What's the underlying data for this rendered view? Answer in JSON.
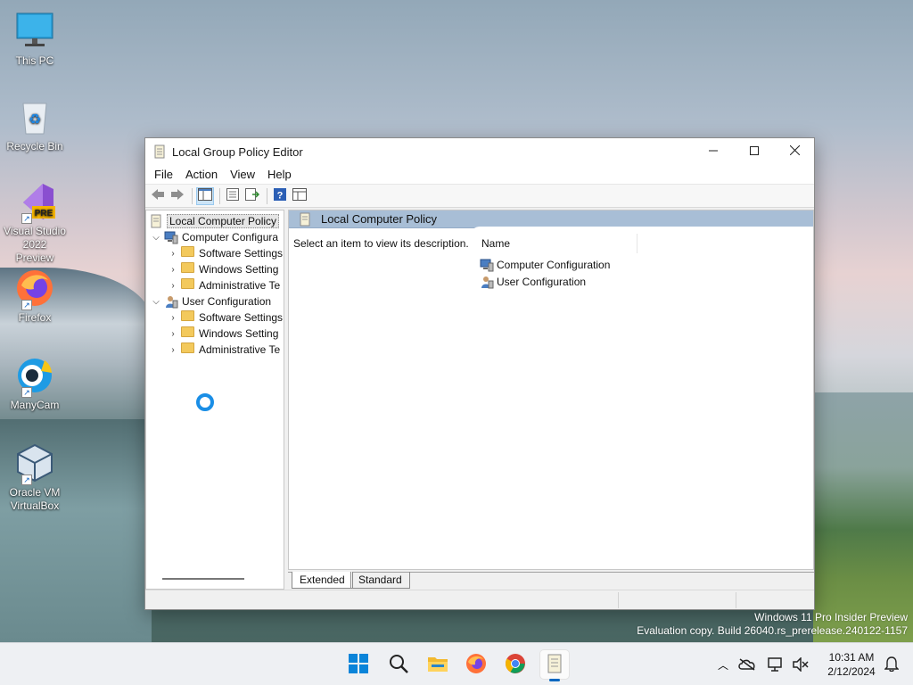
{
  "desktop": {
    "icons": [
      {
        "label": "This PC",
        "icon": "monitor-icon"
      },
      {
        "label": "Recycle Bin",
        "icon": "recycle-bin-icon"
      },
      {
        "label_line1": "Visual Studio",
        "label_line2": "2022 Preview",
        "badge": "PRE",
        "icon": "visual-studio-icon"
      },
      {
        "label": "Firefox",
        "icon": "firefox-icon"
      },
      {
        "label": "ManyCam",
        "icon": "manycam-icon"
      },
      {
        "label_line1": "Oracle VM",
        "label_line2": "VirtualBox",
        "icon": "virtualbox-icon"
      }
    ],
    "watermark": {
      "line1": "Windows 11 Pro Insider Preview",
      "line2": "Evaluation copy. Build 26040.rs_prerelease.240122-1157"
    }
  },
  "window": {
    "title": "Local Group Policy Editor",
    "controls": {
      "minimize": "minimize-icon",
      "maximize": "maximize-icon",
      "close": "close-icon"
    },
    "menu": [
      "File",
      "Action",
      "View",
      "Help"
    ],
    "toolbar": [
      "back-arrow-icon",
      "forward-arrow-icon",
      "show-hide-console-tree-icon",
      "properties-icon",
      "export-list-icon",
      "help-icon",
      "extended-view-icon"
    ],
    "tree": {
      "root": "Local Computer Policy",
      "computer": {
        "label": "Computer Configura",
        "children": [
          "Software Settings",
          "Windows Setting",
          "Administrative Te"
        ]
      },
      "user": {
        "label": "User Configuration",
        "children": [
          "Software Settings",
          "Windows Setting",
          "Administrative Te"
        ]
      }
    },
    "detail": {
      "header": "Local Computer Policy",
      "description": "Select an item to view its description.",
      "column_name": "Name",
      "items": [
        "Computer Configuration",
        "User Configuration"
      ]
    },
    "tabs": [
      "Extended",
      "Standard"
    ]
  },
  "taskbar": {
    "apps": [
      "start-icon",
      "search-icon",
      "file-explorer-icon",
      "firefox-icon",
      "chrome-icon",
      "group-policy-editor-icon"
    ],
    "tray": [
      "chevron-up-icon",
      "onedrive-icon",
      "network-icon",
      "volume-muted-icon"
    ],
    "time": "10:31 AM",
    "date": "2/12/2024",
    "notifications": "bell-icon"
  },
  "colors": {
    "selected_header": "#a8bed6",
    "accent": "#0067c0",
    "spinner": "#1a8ee6"
  }
}
